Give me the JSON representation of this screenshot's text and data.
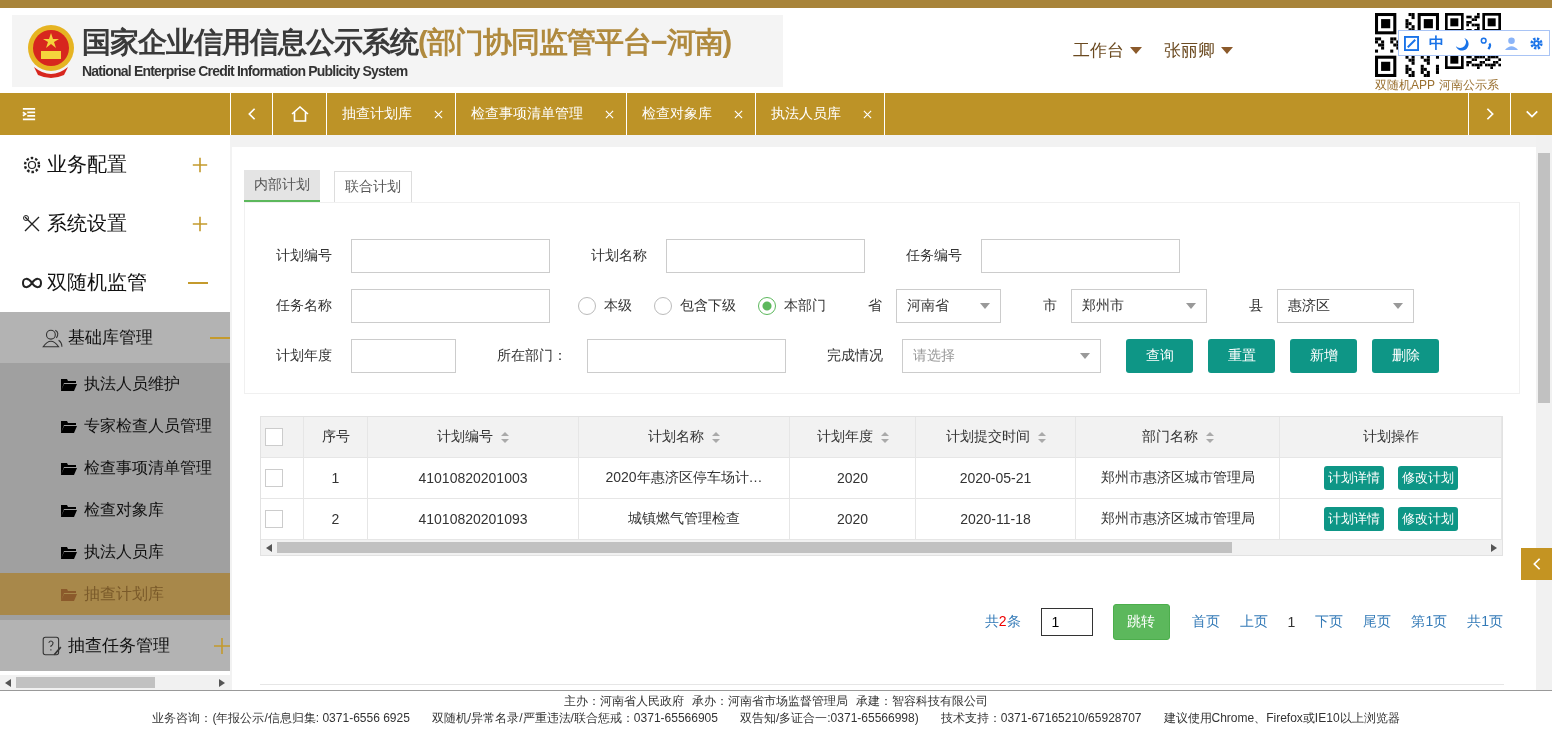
{
  "header": {
    "title": "国家企业信用信息公示系统",
    "subtitle": "(部门协同监管平台−河南)",
    "english": "National Enterprise Credit Information Publicity System",
    "menus": [
      {
        "label": "工作台"
      },
      {
        "label": "张丽卿"
      }
    ],
    "qr_labels": [
      "双随机APP",
      "河南公示系"
    ],
    "toolbar_char": "中"
  },
  "nav_tabs": [
    {
      "label": "抽查计划库"
    },
    {
      "label": "检查事项清单管理"
    },
    {
      "label": "检查对象库"
    },
    {
      "label": "执法人员库"
    }
  ],
  "sidebar": {
    "items": [
      {
        "label": "业务配置",
        "expanded": false
      },
      {
        "label": "系统设置",
        "expanded": false
      },
      {
        "label": "双随机监管",
        "expanded": true,
        "children": [
          {
            "label": "基础库管理",
            "expanded": true,
            "children": [
              {
                "label": "执法人员维护",
                "selected": false
              },
              {
                "label": "专家检查人员管理",
                "selected": false
              },
              {
                "label": "检查事项清单管理",
                "selected": false
              },
              {
                "label": "检查对象库",
                "selected": false
              },
              {
                "label": "执法人员库",
                "selected": false
              },
              {
                "label": "抽查计划库",
                "selected": true
              }
            ]
          },
          {
            "label": "抽查任务管理",
            "expanded": false
          }
        ]
      }
    ]
  },
  "sub_tabs": [
    {
      "label": "内部计划",
      "selected": true
    },
    {
      "label": "联合计划",
      "selected": false
    }
  ],
  "filters": {
    "plan_no": {
      "label": "计划编号"
    },
    "plan_name": {
      "label": "计划名称"
    },
    "task_no": {
      "label": "任务编号"
    },
    "task_name": {
      "label": "任务名称"
    },
    "scope": [
      {
        "label": "本级",
        "selected": false
      },
      {
        "label": "包含下级",
        "selected": false
      },
      {
        "label": "本部门",
        "selected": true
      }
    ],
    "province": {
      "label": "省",
      "value": "河南省"
    },
    "city": {
      "label": "市",
      "value": "郑州市"
    },
    "county": {
      "label": "县",
      "value": "惠济区"
    },
    "year": {
      "label": "计划年度"
    },
    "dept": {
      "label": "所在部门："
    },
    "status": {
      "label": "完成情况",
      "placeholder": "请选择"
    },
    "buttons": [
      "查询",
      "重置",
      "新增",
      "删除"
    ]
  },
  "table": {
    "all_checked": false,
    "columns": [
      {
        "label": "序号",
        "sortable": false
      },
      {
        "label": "计划编号",
        "sortable": true
      },
      {
        "label": "计划名称",
        "sortable": true
      },
      {
        "label": "计划年度",
        "sortable": true
      },
      {
        "label": "计划提交时间",
        "sortable": true
      },
      {
        "label": "部门名称",
        "sortable": true
      },
      {
        "label": "计划操作",
        "sortable": false
      }
    ],
    "rows": [
      {
        "checked": false,
        "cells": [
          "1",
          "41010820201003",
          "2020年惠济区停车场计…",
          "2020",
          "2020-05-21",
          "郑州市惠济区城市管理局"
        ],
        "actions": [
          "计划详情",
          "修改计划"
        ]
      },
      {
        "checked": false,
        "cells": [
          "2",
          "41010820201093",
          "城镇燃气管理检查",
          "2020",
          "2020-11-18",
          "郑州市惠济区城市管理局"
        ],
        "actions": [
          "计划详情",
          "修改计划"
        ]
      }
    ]
  },
  "pagination": {
    "total_prefix": "共",
    "total": "2",
    "total_suffix": "条",
    "page_input": "1",
    "jump": "跳转",
    "links": [
      "首页",
      "上页"
    ],
    "current": "1",
    "links_after": [
      "下页",
      "尾页",
      "第1页",
      "共1页"
    ]
  },
  "footer": {
    "line1": [
      "主办：河南省人民政府",
      "承办：河南省市场监督管理局",
      "承建：智容科技有限公司"
    ],
    "line2": [
      "业务咨询：(年报公示/信息归集: 0371-6556 6925",
      "双随机/异常名录/严重违法/联合惩戒：0371-65566905",
      "双告知/多证合一:0371-65566998)",
      "技术支持：0371-67165210/65928707",
      "建议使用Chrome、Firefox或IE10以上浏览器"
    ]
  }
}
